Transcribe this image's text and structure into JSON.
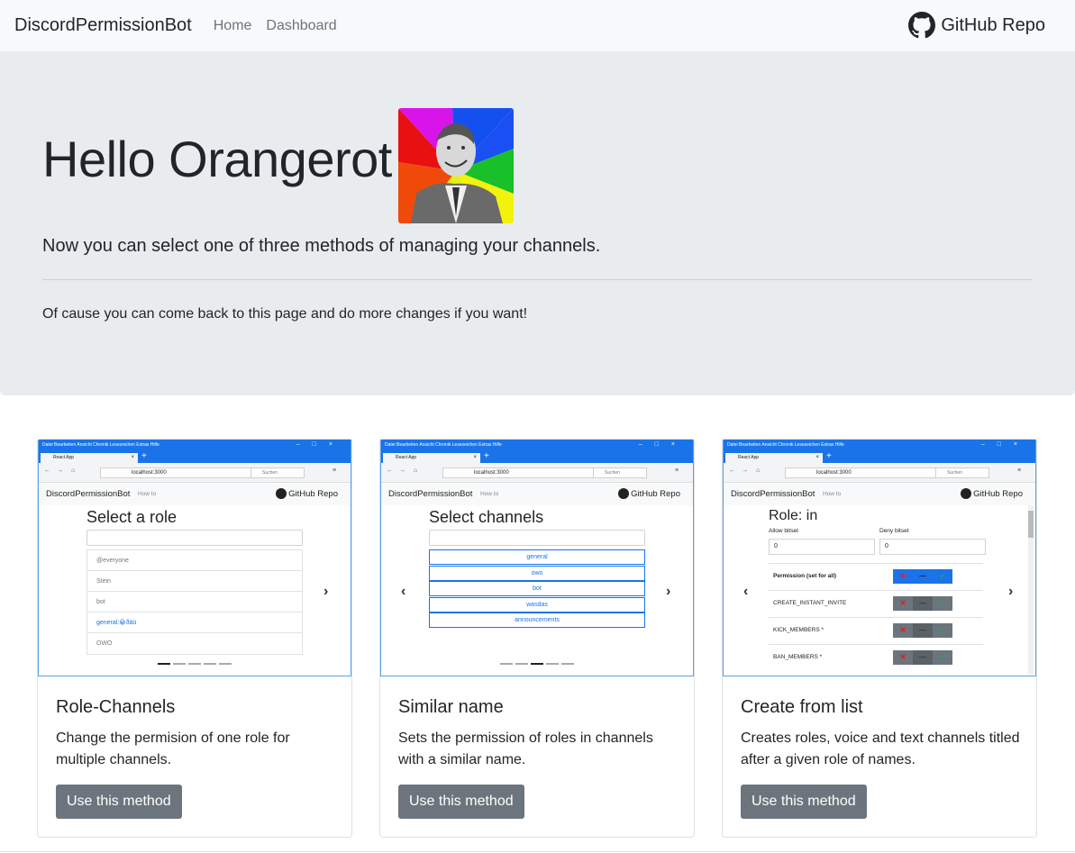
{
  "navbar": {
    "brand": "DiscordPermissionBot",
    "links": [
      "Home",
      "Dashboard"
    ],
    "repo_label": "GitHub Repo"
  },
  "jumbotron": {
    "title": "Hello Orangerot",
    "lead": "Now you can select one of three methods of managing your channels.",
    "note": "Of cause you can come back to this page and do more changes if you want!"
  },
  "mini_browser": {
    "menu": "Datei  Bearbeiten  Ansicht  Chronik  Lesezeichen  Extras  Hilfe",
    "window_controls": "–□×",
    "tab_title": "React App",
    "tab_close": "×",
    "new_tab": "+",
    "url": "localhost:3000",
    "search_placeholder": "Suchen",
    "brand": "DiscordPermissionBot",
    "how_to": "How to",
    "repo_label": "GitHub Repo"
  },
  "cards": [
    {
      "title": "Role-Channels",
      "text": "Change the permision of one role for multiple channels.",
      "button": "Use this method",
      "preview": {
        "heading": "Select a role",
        "items": [
          "@everyone",
          "Stein",
          "bot",
          "general:😀ðäü",
          "OWO"
        ]
      }
    },
    {
      "title": "Similar name",
      "text": "Sets the permission of roles in channels with a similar name.",
      "button": "Use this method",
      "preview": {
        "heading": "Select channels",
        "items": [
          "general",
          "owo",
          "bot",
          "wasdas",
          "announcements"
        ]
      }
    },
    {
      "title": "Create from list",
      "text": "Creates roles, voice and text channels titled after a given role of names.",
      "button": "Use this method",
      "preview": {
        "heading": "Role: in",
        "allow_label": "Allow bitset",
        "deny_label": "Deny bitset",
        "allow_value": "0",
        "deny_value": "0",
        "rows": [
          "Permission (set for all)",
          "CREATE_INSTANT_INVITE",
          "KICK_MEMBERS *",
          "BAN_MEMBERS *"
        ]
      }
    }
  ],
  "colors": {
    "navbar_bg": "#f8f9fa",
    "jumbotron_bg": "#e9ecef",
    "button_bg": "#6c757d",
    "accent": "#1a73e8"
  }
}
